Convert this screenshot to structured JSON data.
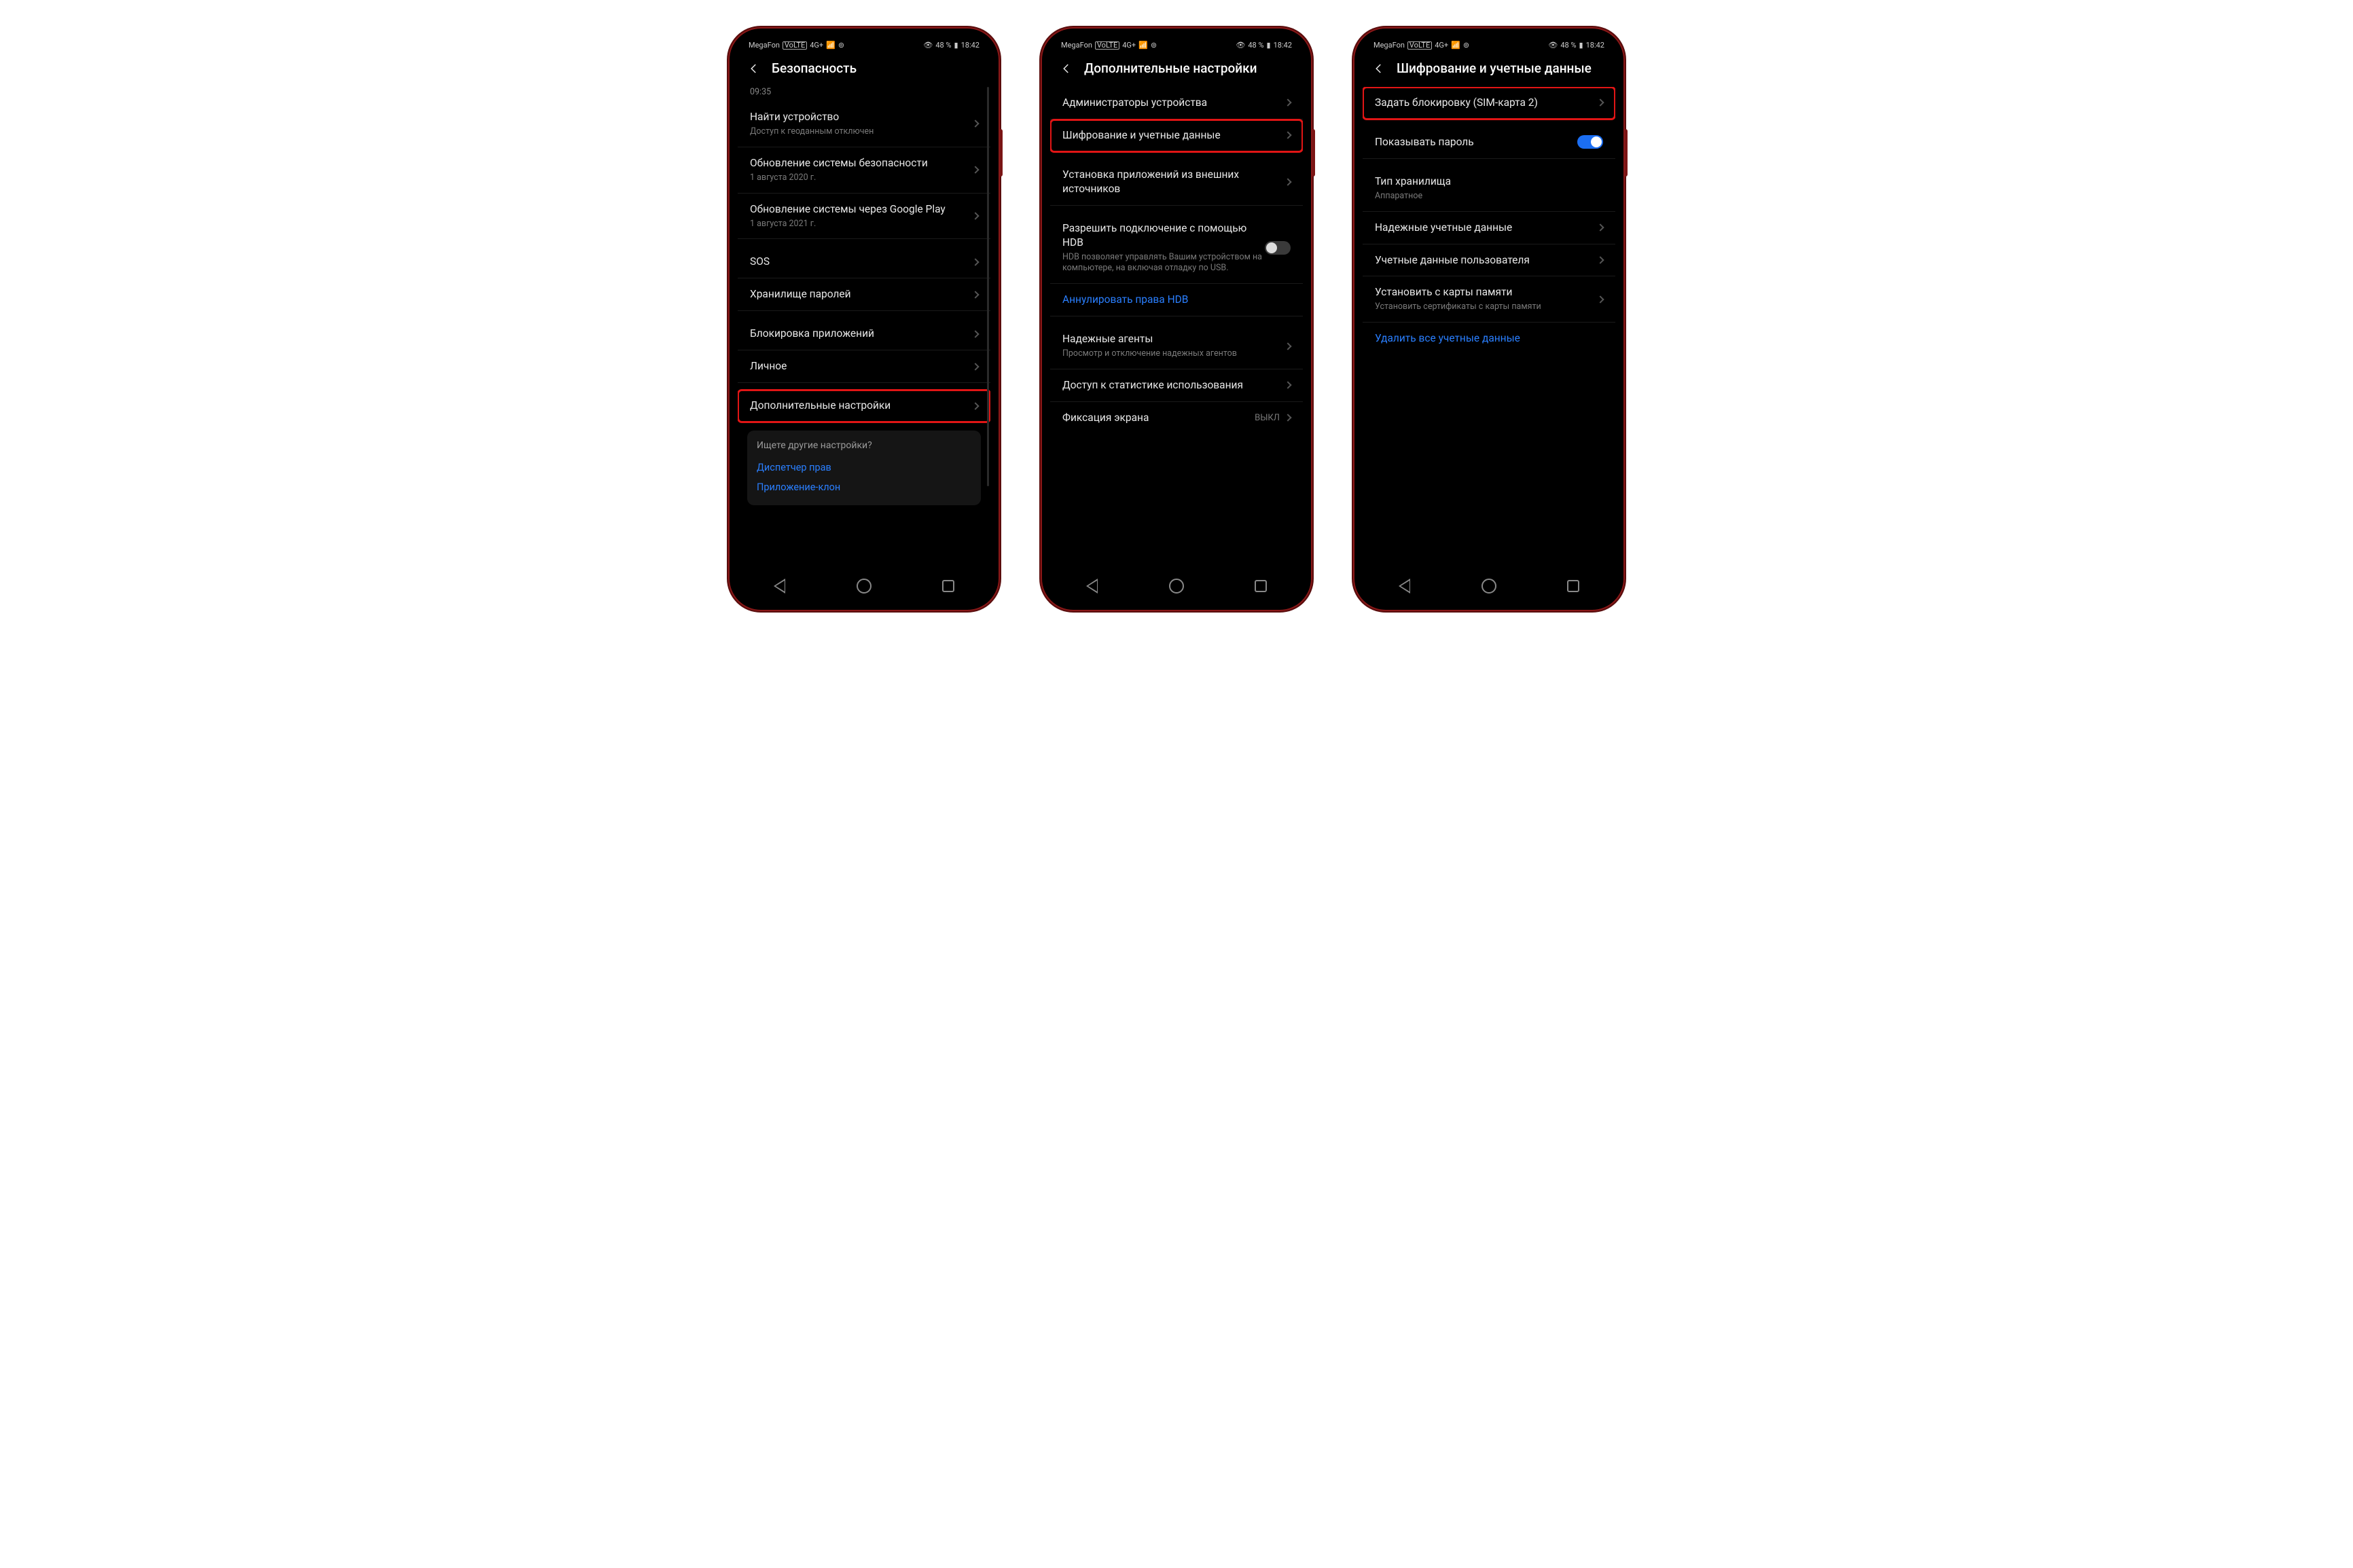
{
  "statusbar": {
    "carrier": "MegaFon",
    "volte": "VoLTE",
    "net": "4G+",
    "signal": "𝗂𝗅𝗅",
    "hotspot": "@",
    "alarm": "⏱",
    "battery_pct": "48 %",
    "time": "18:42"
  },
  "phone1": {
    "title": "Безопасность",
    "prev_time": "09:35",
    "rows": {
      "find": {
        "label": "Найти устройство",
        "sub": "Доступ к геоданным отключен"
      },
      "secupd": {
        "label": "Обновление системы безопасности",
        "sub": "1 августа 2020 г."
      },
      "gplay": {
        "label": "Обновление системы через Google Play",
        "sub": "1 августа 2021 г."
      },
      "sos": {
        "label": "SOS"
      },
      "pwstore": {
        "label": "Хранилище паролей"
      },
      "applock": {
        "label": "Блокировка приложений"
      },
      "private": {
        "label": "Личное"
      },
      "more": {
        "label": "Дополнительные настройки"
      }
    },
    "card": {
      "title": "Ищете другие настройки?",
      "link1": "Диспетчер прав",
      "link2": "Приложение-клон"
    }
  },
  "phone2": {
    "title": "Дополнительные настройки",
    "rows": {
      "admins": {
        "label": "Администраторы устройства"
      },
      "encrypt": {
        "label": "Шифрование и учетные данные"
      },
      "install": {
        "label": "Установка приложений из внешних источников"
      },
      "hdb": {
        "label": "Разрешить подключение с помощью HDB",
        "sub": "HDB позволяет управлять Вашим устройством на компьютере, на включая отладку по USB."
      },
      "hdb_revoke": {
        "label": "Аннулировать права HDB"
      },
      "trusted": {
        "label": "Надежные агенты",
        "sub": "Просмотр и отключение надежных агентов"
      },
      "usage": {
        "label": "Доступ к статистике использования"
      },
      "pin": {
        "label": "Фиксация экрана",
        "value": "ВЫКЛ"
      }
    }
  },
  "phone3": {
    "title": "Шифрование и учетные данные",
    "rows": {
      "simlock": {
        "label": "Задать блокировку (SIM-карта 2)"
      },
      "showpw": {
        "label": "Показывать пароль"
      },
      "storetype": {
        "label": "Тип хранилища",
        "sub": "Аппаратное"
      },
      "trustedcreds": {
        "label": "Надежные учетные данные"
      },
      "usercreds": {
        "label": "Учетные данные пользователя"
      },
      "installsd": {
        "label": "Установить с карты памяти",
        "sub": "Установить сертификаты с карты памяти"
      },
      "clear": {
        "label": "Удалить все учетные данные"
      }
    }
  }
}
